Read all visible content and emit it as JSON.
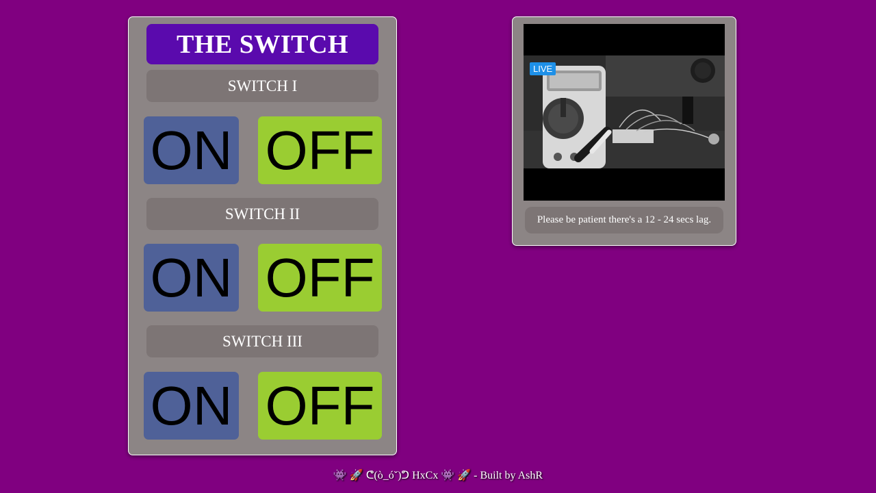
{
  "switch_panel": {
    "title": "THE SWITCH",
    "switches": [
      {
        "label": "SWITCH I",
        "on_label": "ON",
        "off_label": "OFF"
      },
      {
        "label": "SWITCH II",
        "on_label": "ON",
        "off_label": "OFF"
      },
      {
        "label": "SWITCH III",
        "on_label": "ON",
        "off_label": "OFF"
      }
    ]
  },
  "stream_panel": {
    "live_badge": "LIVE",
    "note": "Please be patient there's a 12 - 24 secs lag."
  },
  "footer": {
    "text": "👾 🚀 ᕦ(ò_óˇ)ᕤ HxCx 👾 🚀 - Built by AshR"
  },
  "colors": {
    "background": "#800080",
    "panel": "#8c8585",
    "title_bg": "#5a0aad",
    "label_bg": "#7d7575",
    "on_button": "#4f6198",
    "off_button": "#9acd32",
    "live_badge": "#1e90e8"
  }
}
